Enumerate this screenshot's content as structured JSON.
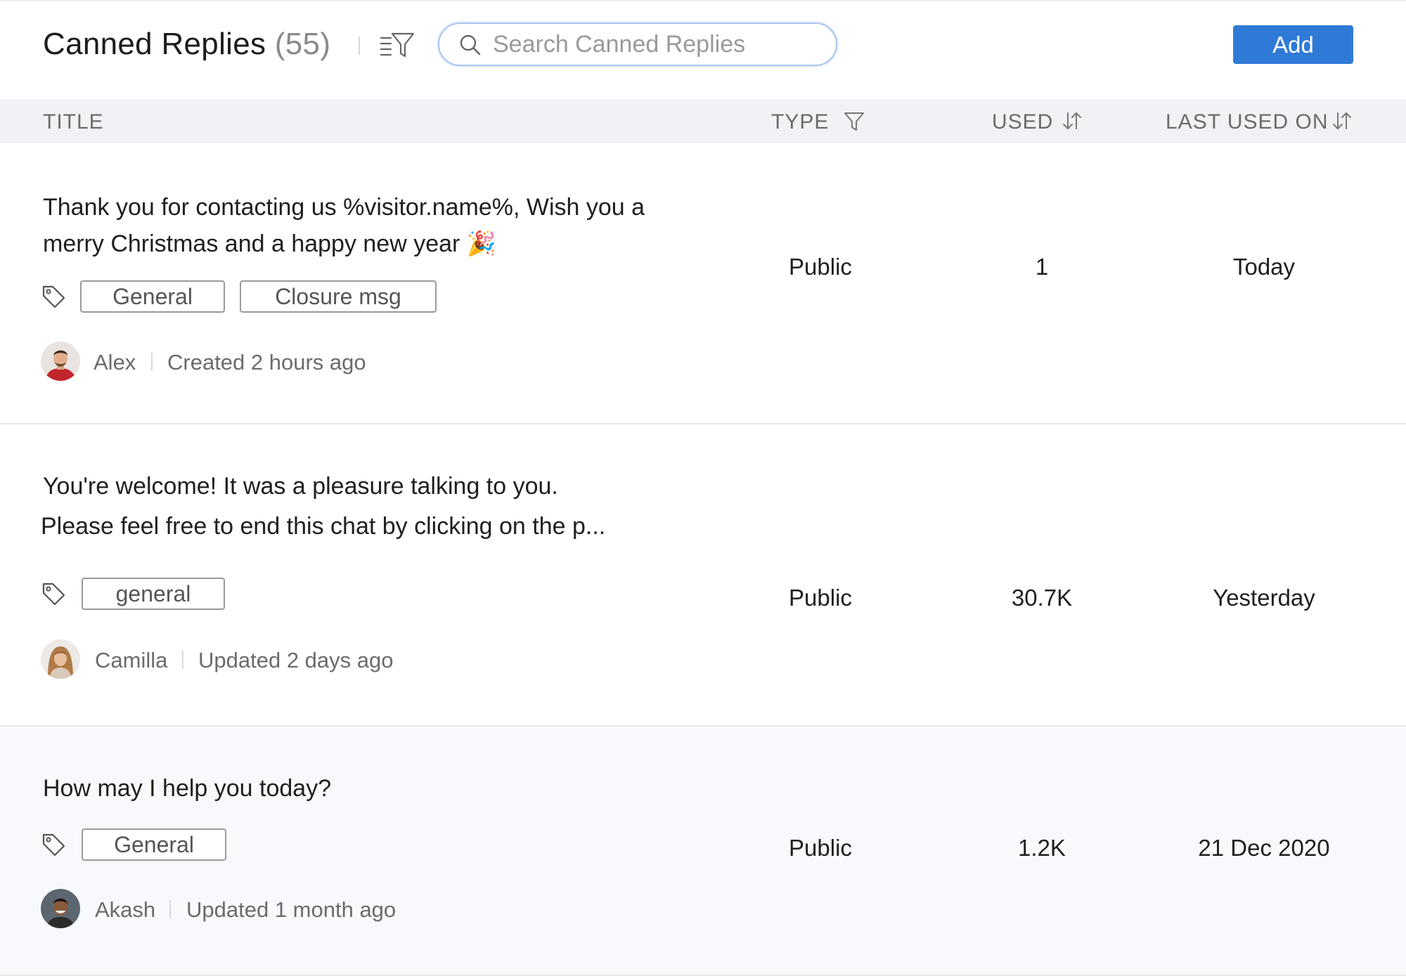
{
  "header": {
    "title": "Canned Replies",
    "count": "(55)",
    "search_placeholder": "Search Canned Replies",
    "add_label": "Add"
  },
  "columns": {
    "title": "TITLE",
    "type": "TYPE",
    "used": "USED",
    "last_used_on": "LAST USED ON"
  },
  "rows": [
    {
      "text_line1": "Thank you for contacting us %visitor.name%, Wish you a",
      "text_line2": "merry Christmas and a happy new year 🎉",
      "tags": [
        "General",
        "Closure msg"
      ],
      "author": "Alex",
      "status": "Created 2 hours ago",
      "type": "Public",
      "used": "1",
      "last_used": "Today"
    },
    {
      "text_line1": "You're welcome! It was a pleasure talking to you.",
      "text_line2": "Please feel free to end this chat by clicking on the p...",
      "tags": [
        "general"
      ],
      "author": "Camilla",
      "status": "Updated 2 days ago",
      "type": "Public",
      "used": "30.7K",
      "last_used": "Yesterday"
    },
    {
      "text_line1": "How may I help you today?",
      "tags": [
        "General"
      ],
      "author": "Akash",
      "status": "Updated 1 month ago",
      "type": "Public",
      "used": "1.2K",
      "last_used": "21 Dec 2020"
    }
  ],
  "colors": {
    "accent": "#2f7ad6",
    "header_bg": "#f0f2f5",
    "search_border": "#a9c4ef"
  },
  "icons": [
    "filter-list-icon",
    "search-icon",
    "funnel-icon",
    "sort-icon",
    "tag-icon"
  ]
}
